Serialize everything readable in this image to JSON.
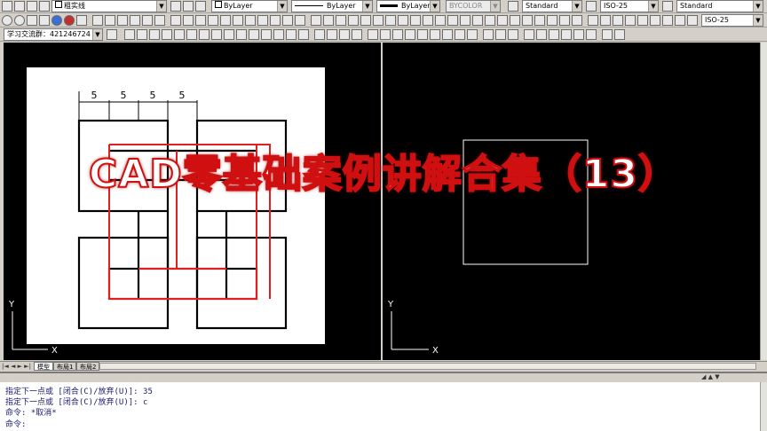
{
  "toolbar1": {
    "linetype_name": "粗实线",
    "color_combo": "ByLayer",
    "linetype_combo": "ByLayer",
    "lineweight_combo": "ByLayer",
    "plotstyle_combo": "BYCOLOR",
    "text_style": "Standard",
    "dim_style": "ISO-25",
    "table_style": "Standard"
  },
  "toolbar2": {
    "workspace": "学习交流群：421246724",
    "dim_style2": "ISO-25"
  },
  "overlay_title": "CAD零基础案例讲解合集（13）",
  "dimension_labels": [
    "5",
    "5",
    "5",
    "5"
  ],
  "tabs": [
    "模型",
    "布局1",
    "布局2"
  ],
  "axis": {
    "x": "X",
    "y": "Y"
  },
  "command_lines": [
    "指定下一点或 [闭合(C)/放弃(U)]: 35",
    "指定下一点或 [闭合(C)/放弃(U)]: c",
    "命令: *取消*",
    "命令:"
  ],
  "colors": {
    "accent_red": "#e02020",
    "title_fill": "#ffffff",
    "title_stroke": "#d01010"
  }
}
